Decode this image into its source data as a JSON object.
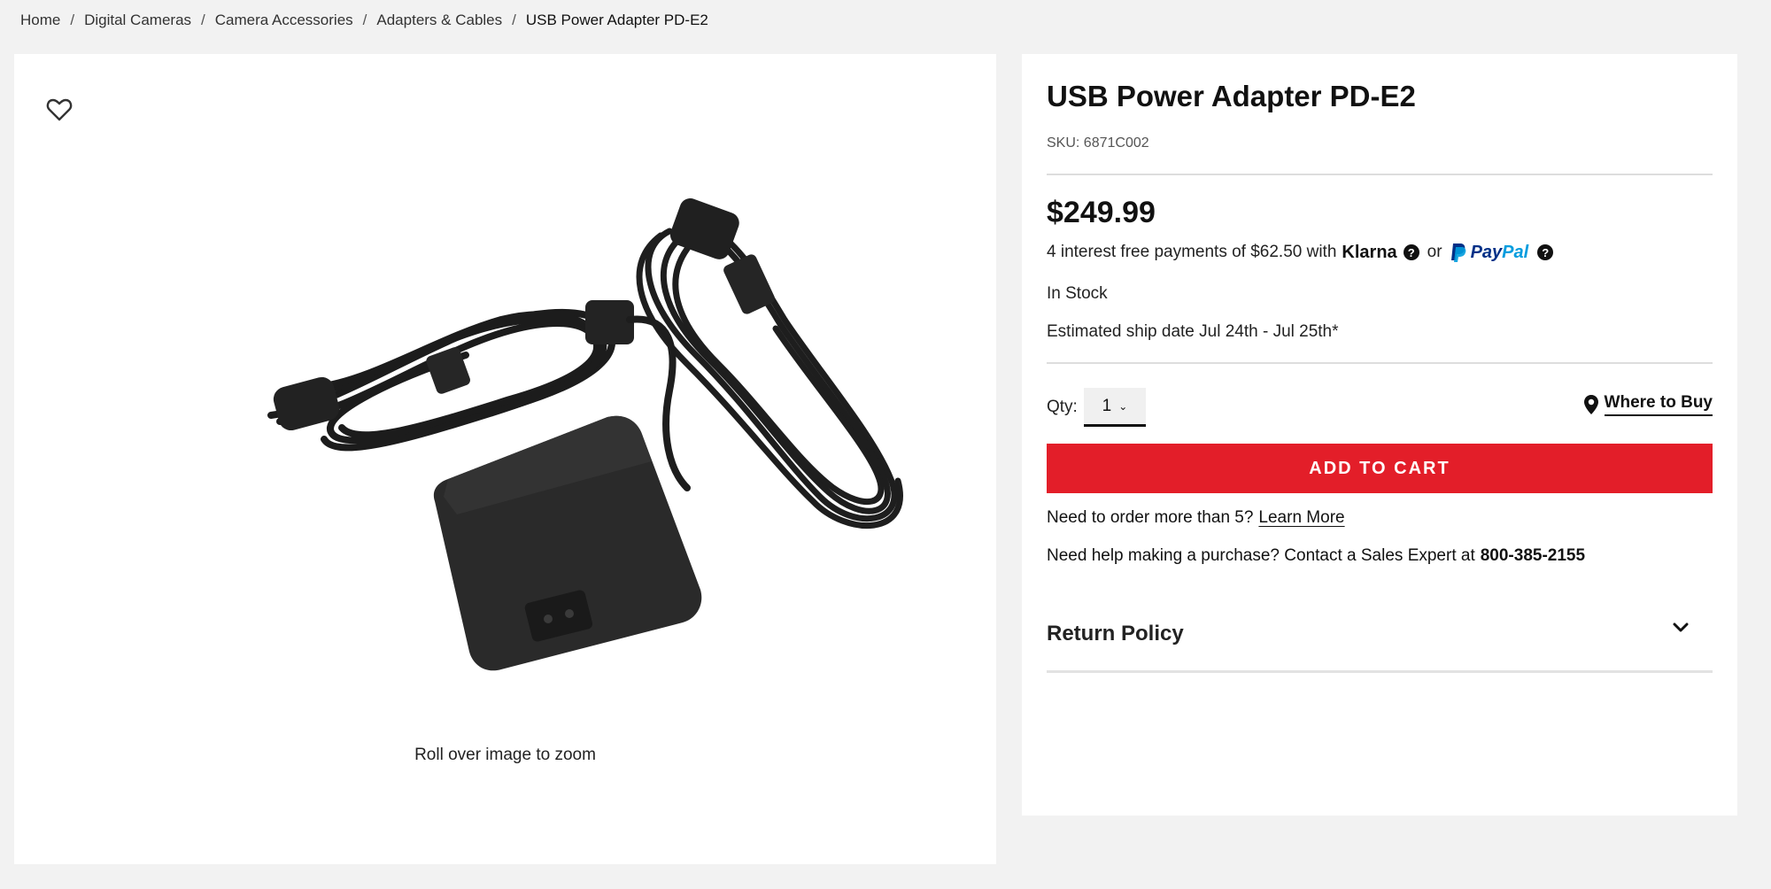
{
  "breadcrumb": {
    "items": [
      "Home",
      "Digital Cameras",
      "Camera Accessories",
      "Adapters & Cables"
    ],
    "separator": "/",
    "current": "USB Power Adapter PD-E2"
  },
  "gallery": {
    "wishlist_icon": "heart-outline-icon",
    "zoom_hint": "Roll over image to zoom"
  },
  "product": {
    "title": "USB Power Adapter PD-E2",
    "sku": "SKU: 6871C002",
    "price": "$249.99",
    "payments": {
      "text": "4 interest free payments of $62.50 with",
      "klarna": "Klarna",
      "or": "or",
      "paypal_pay": "Pay",
      "paypal_pal": "Pal",
      "help_icon": "?"
    },
    "stock": "In Stock",
    "ship_date": "Estimated ship date Jul 24th - Jul 25th*",
    "qty_label": "Qty:",
    "qty_value": "1",
    "where_to_buy": "Where to Buy",
    "add_to_cart": "ADD TO CART",
    "order_more_text": "Need to order more than 5?",
    "learn_more": "Learn More",
    "help_text": "Need help making a purchase? Contact a Sales Expert at",
    "phone": "800-385-2155",
    "return_policy": "Return Policy"
  },
  "colors": {
    "accent": "#e31e29",
    "paypal_dark": "#003087",
    "paypal_light": "#009cde",
    "background": "#f2f2f2"
  }
}
